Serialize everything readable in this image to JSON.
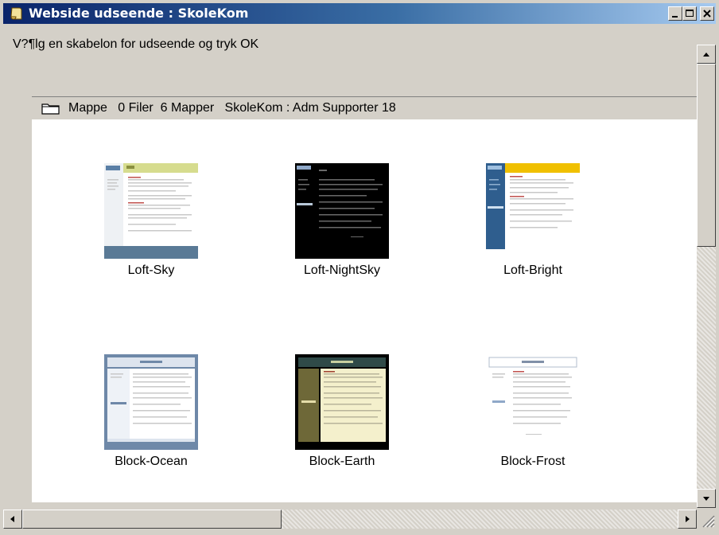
{
  "window": {
    "title": "Webside udseende : SkoleKom",
    "title_icon": "scroll-icon",
    "controls": [
      "minimize-icon",
      "maximize-icon",
      "close-icon"
    ]
  },
  "instruction": "V?¶lg en skabelon for udseende og tryk OK",
  "statusbar": {
    "icon": "folder-icon",
    "folder_label": "Mappe",
    "files": "0 Filer",
    "folders": "6 Mapper",
    "location": "SkoleKom : Adm Supporter 18"
  },
  "templates": [
    {
      "name": "Loft-Sky"
    },
    {
      "name": "Loft-NightSky"
    },
    {
      "name": "Loft-Bright"
    },
    {
      "name": "Block-Ocean"
    },
    {
      "name": "Block-Earth"
    },
    {
      "name": "Block-Frost"
    }
  ],
  "colors": {
    "titlebar_start": "#0a246a",
    "titlebar_end": "#a6caf0",
    "face": "#d4d0c8",
    "panel": "#ffffff"
  }
}
